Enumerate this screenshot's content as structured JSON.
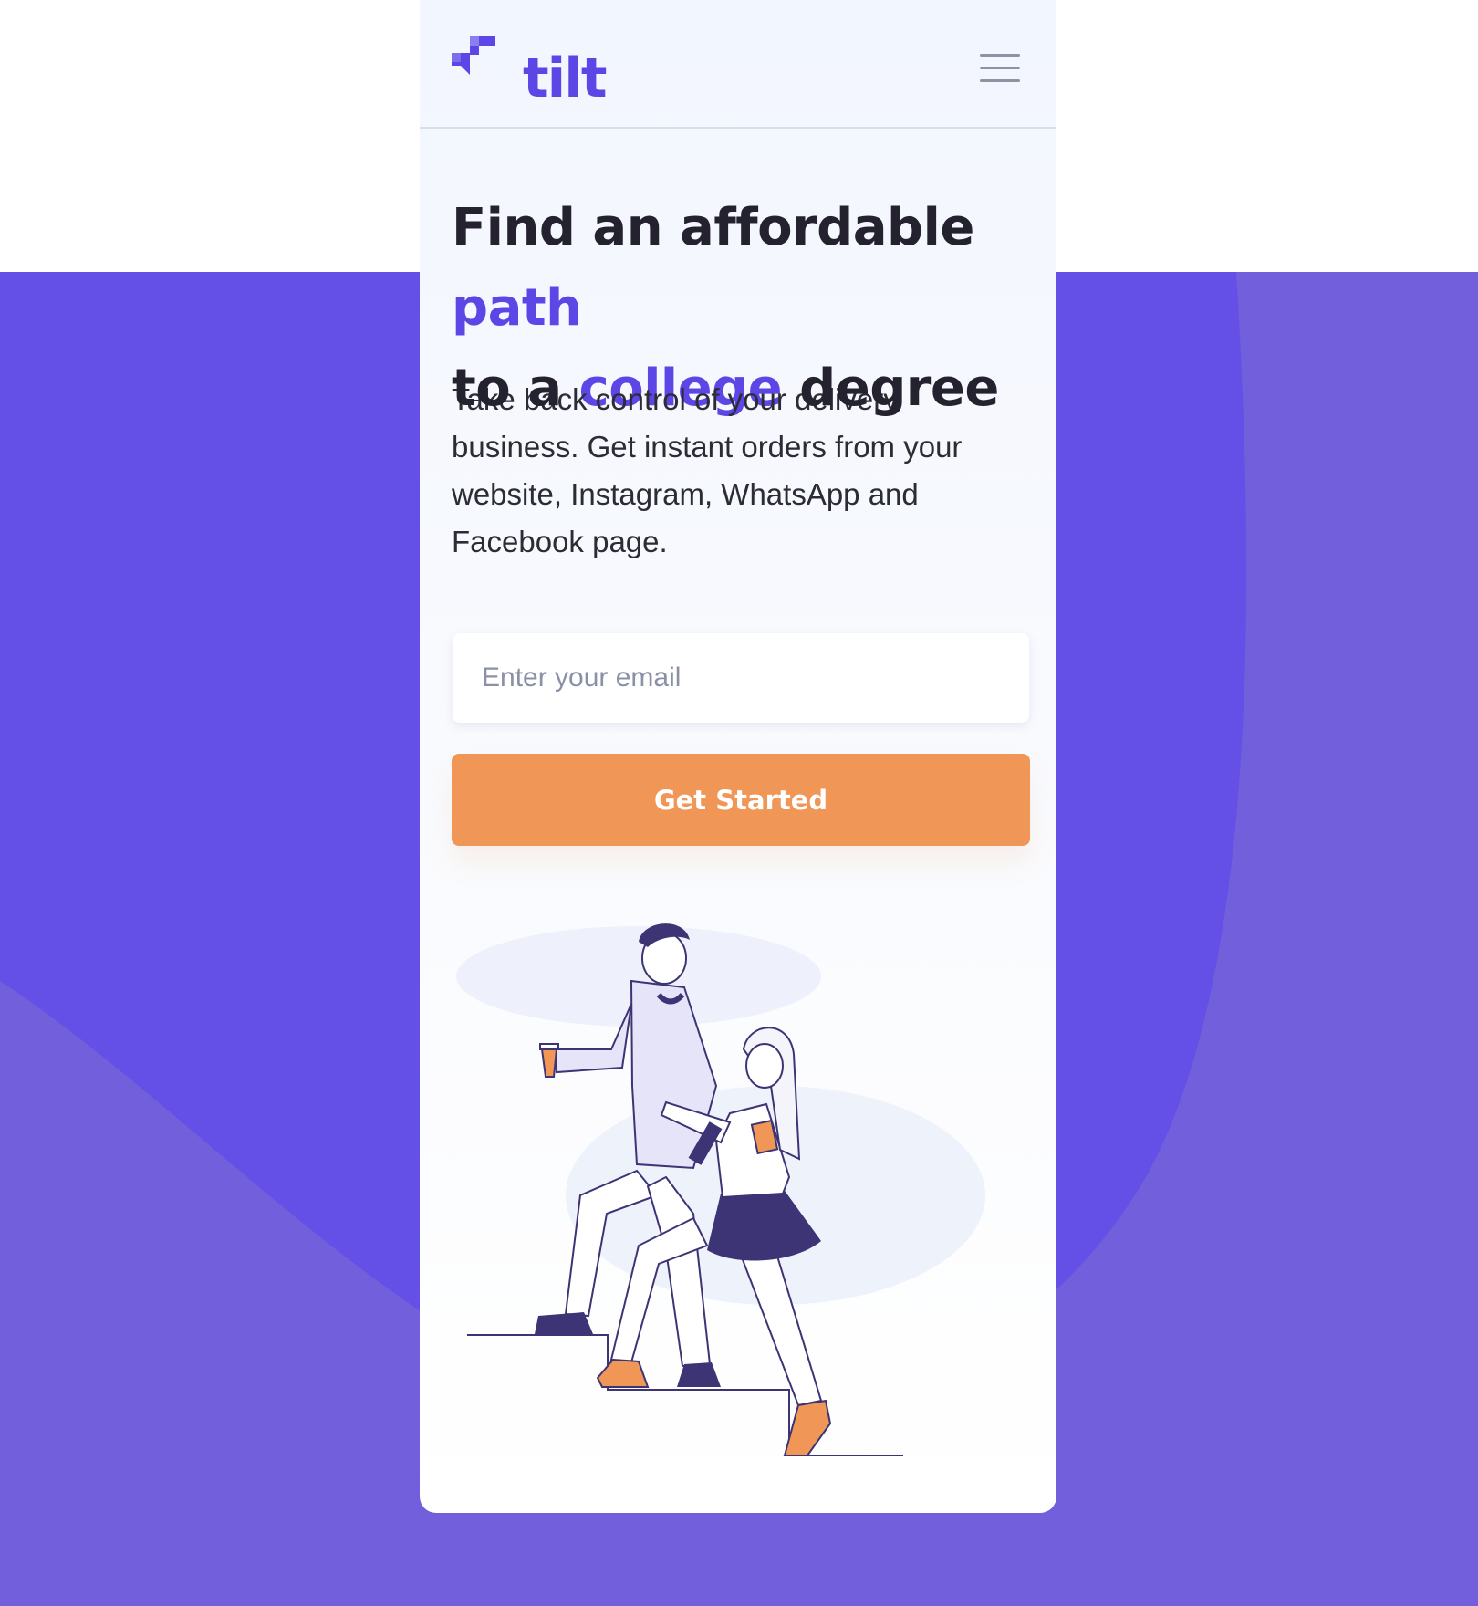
{
  "brand": {
    "name": "tilt",
    "color": "#5c47e6",
    "logo_icon": "stacked-blocks-logo-icon"
  },
  "header": {
    "menu_icon": "hamburger-menu-icon"
  },
  "hero": {
    "headline_part1": "Find an affordable ",
    "headline_highlight1": "path",
    "headline_part2": "to a ",
    "headline_highlight2": "college",
    "headline_part3": " degree",
    "description": "Take back control of your delivery business. Get instant orders from your website, Instagram, WhatsApp and Facebook page."
  },
  "form": {
    "email_placeholder": "Enter your email",
    "email_value": "",
    "cta_label": "Get Started"
  },
  "illustration": {
    "icon": "students-walking-up-stairs-illustration"
  },
  "colors": {
    "accent": "#5c47e6",
    "background_purple": "#6450e6",
    "background_purple_light": "#725fdc",
    "cta": "#f09757",
    "text_dark": "#23222e",
    "figure_navy": "#3d3475"
  }
}
